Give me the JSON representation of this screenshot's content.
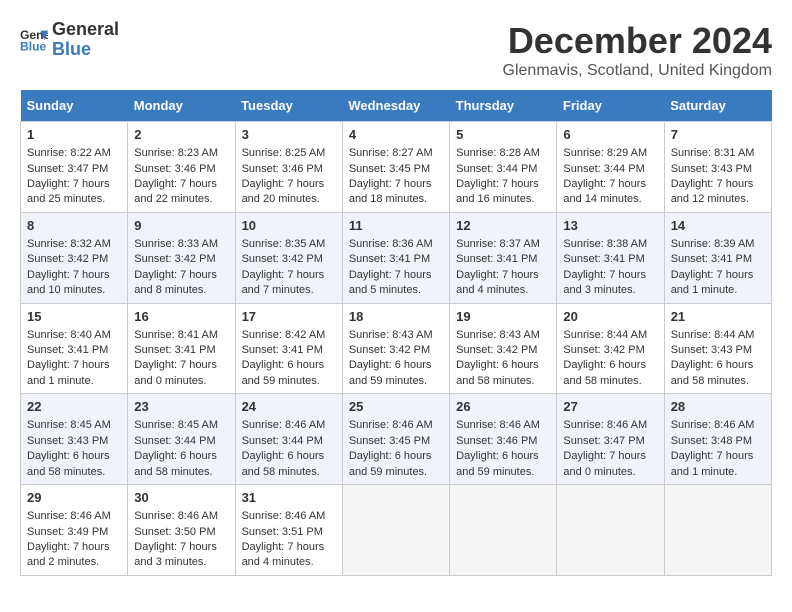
{
  "header": {
    "logo_line1": "General",
    "logo_line2": "Blue",
    "month": "December 2024",
    "location": "Glenmavis, Scotland, United Kingdom"
  },
  "columns": [
    "Sunday",
    "Monday",
    "Tuesday",
    "Wednesday",
    "Thursday",
    "Friday",
    "Saturday"
  ],
  "weeks": [
    [
      {
        "day": "1",
        "lines": [
          "Sunrise: 8:22 AM",
          "Sunset: 3:47 PM",
          "Daylight: 7 hours",
          "and 25 minutes."
        ]
      },
      {
        "day": "2",
        "lines": [
          "Sunrise: 8:23 AM",
          "Sunset: 3:46 PM",
          "Daylight: 7 hours",
          "and 22 minutes."
        ]
      },
      {
        "day": "3",
        "lines": [
          "Sunrise: 8:25 AM",
          "Sunset: 3:46 PM",
          "Daylight: 7 hours",
          "and 20 minutes."
        ]
      },
      {
        "day": "4",
        "lines": [
          "Sunrise: 8:27 AM",
          "Sunset: 3:45 PM",
          "Daylight: 7 hours",
          "and 18 minutes."
        ]
      },
      {
        "day": "5",
        "lines": [
          "Sunrise: 8:28 AM",
          "Sunset: 3:44 PM",
          "Daylight: 7 hours",
          "and 16 minutes."
        ]
      },
      {
        "day": "6",
        "lines": [
          "Sunrise: 8:29 AM",
          "Sunset: 3:44 PM",
          "Daylight: 7 hours",
          "and 14 minutes."
        ]
      },
      {
        "day": "7",
        "lines": [
          "Sunrise: 8:31 AM",
          "Sunset: 3:43 PM",
          "Daylight: 7 hours",
          "and 12 minutes."
        ]
      }
    ],
    [
      {
        "day": "8",
        "lines": [
          "Sunrise: 8:32 AM",
          "Sunset: 3:42 PM",
          "Daylight: 7 hours",
          "and 10 minutes."
        ]
      },
      {
        "day": "9",
        "lines": [
          "Sunrise: 8:33 AM",
          "Sunset: 3:42 PM",
          "Daylight: 7 hours",
          "and 8 minutes."
        ]
      },
      {
        "day": "10",
        "lines": [
          "Sunrise: 8:35 AM",
          "Sunset: 3:42 PM",
          "Daylight: 7 hours",
          "and 7 minutes."
        ]
      },
      {
        "day": "11",
        "lines": [
          "Sunrise: 8:36 AM",
          "Sunset: 3:41 PM",
          "Daylight: 7 hours",
          "and 5 minutes."
        ]
      },
      {
        "day": "12",
        "lines": [
          "Sunrise: 8:37 AM",
          "Sunset: 3:41 PM",
          "Daylight: 7 hours",
          "and 4 minutes."
        ]
      },
      {
        "day": "13",
        "lines": [
          "Sunrise: 8:38 AM",
          "Sunset: 3:41 PM",
          "Daylight: 7 hours",
          "and 3 minutes."
        ]
      },
      {
        "day": "14",
        "lines": [
          "Sunrise: 8:39 AM",
          "Sunset: 3:41 PM",
          "Daylight: 7 hours",
          "and 1 minute."
        ]
      }
    ],
    [
      {
        "day": "15",
        "lines": [
          "Sunrise: 8:40 AM",
          "Sunset: 3:41 PM",
          "Daylight: 7 hours",
          "and 1 minute."
        ]
      },
      {
        "day": "16",
        "lines": [
          "Sunrise: 8:41 AM",
          "Sunset: 3:41 PM",
          "Daylight: 7 hours",
          "and 0 minutes."
        ]
      },
      {
        "day": "17",
        "lines": [
          "Sunrise: 8:42 AM",
          "Sunset: 3:41 PM",
          "Daylight: 6 hours",
          "and 59 minutes."
        ]
      },
      {
        "day": "18",
        "lines": [
          "Sunrise: 8:43 AM",
          "Sunset: 3:42 PM",
          "Daylight: 6 hours",
          "and 59 minutes."
        ]
      },
      {
        "day": "19",
        "lines": [
          "Sunrise: 8:43 AM",
          "Sunset: 3:42 PM",
          "Daylight: 6 hours",
          "and 58 minutes."
        ]
      },
      {
        "day": "20",
        "lines": [
          "Sunrise: 8:44 AM",
          "Sunset: 3:42 PM",
          "Daylight: 6 hours",
          "and 58 minutes."
        ]
      },
      {
        "day": "21",
        "lines": [
          "Sunrise: 8:44 AM",
          "Sunset: 3:43 PM",
          "Daylight: 6 hours",
          "and 58 minutes."
        ]
      }
    ],
    [
      {
        "day": "22",
        "lines": [
          "Sunrise: 8:45 AM",
          "Sunset: 3:43 PM",
          "Daylight: 6 hours",
          "and 58 minutes."
        ]
      },
      {
        "day": "23",
        "lines": [
          "Sunrise: 8:45 AM",
          "Sunset: 3:44 PM",
          "Daylight: 6 hours",
          "and 58 minutes."
        ]
      },
      {
        "day": "24",
        "lines": [
          "Sunrise: 8:46 AM",
          "Sunset: 3:44 PM",
          "Daylight: 6 hours",
          "and 58 minutes."
        ]
      },
      {
        "day": "25",
        "lines": [
          "Sunrise: 8:46 AM",
          "Sunset: 3:45 PM",
          "Daylight: 6 hours",
          "and 59 minutes."
        ]
      },
      {
        "day": "26",
        "lines": [
          "Sunrise: 8:46 AM",
          "Sunset: 3:46 PM",
          "Daylight: 6 hours",
          "and 59 minutes."
        ]
      },
      {
        "day": "27",
        "lines": [
          "Sunrise: 8:46 AM",
          "Sunset: 3:47 PM",
          "Daylight: 7 hours",
          "and 0 minutes."
        ]
      },
      {
        "day": "28",
        "lines": [
          "Sunrise: 8:46 AM",
          "Sunset: 3:48 PM",
          "Daylight: 7 hours",
          "and 1 minute."
        ]
      }
    ],
    [
      {
        "day": "29",
        "lines": [
          "Sunrise: 8:46 AM",
          "Sunset: 3:49 PM",
          "Daylight: 7 hours",
          "and 2 minutes."
        ]
      },
      {
        "day": "30",
        "lines": [
          "Sunrise: 8:46 AM",
          "Sunset: 3:50 PM",
          "Daylight: 7 hours",
          "and 3 minutes."
        ]
      },
      {
        "day": "31",
        "lines": [
          "Sunrise: 8:46 AM",
          "Sunset: 3:51 PM",
          "Daylight: 7 hours",
          "and 4 minutes."
        ]
      },
      null,
      null,
      null,
      null
    ]
  ]
}
